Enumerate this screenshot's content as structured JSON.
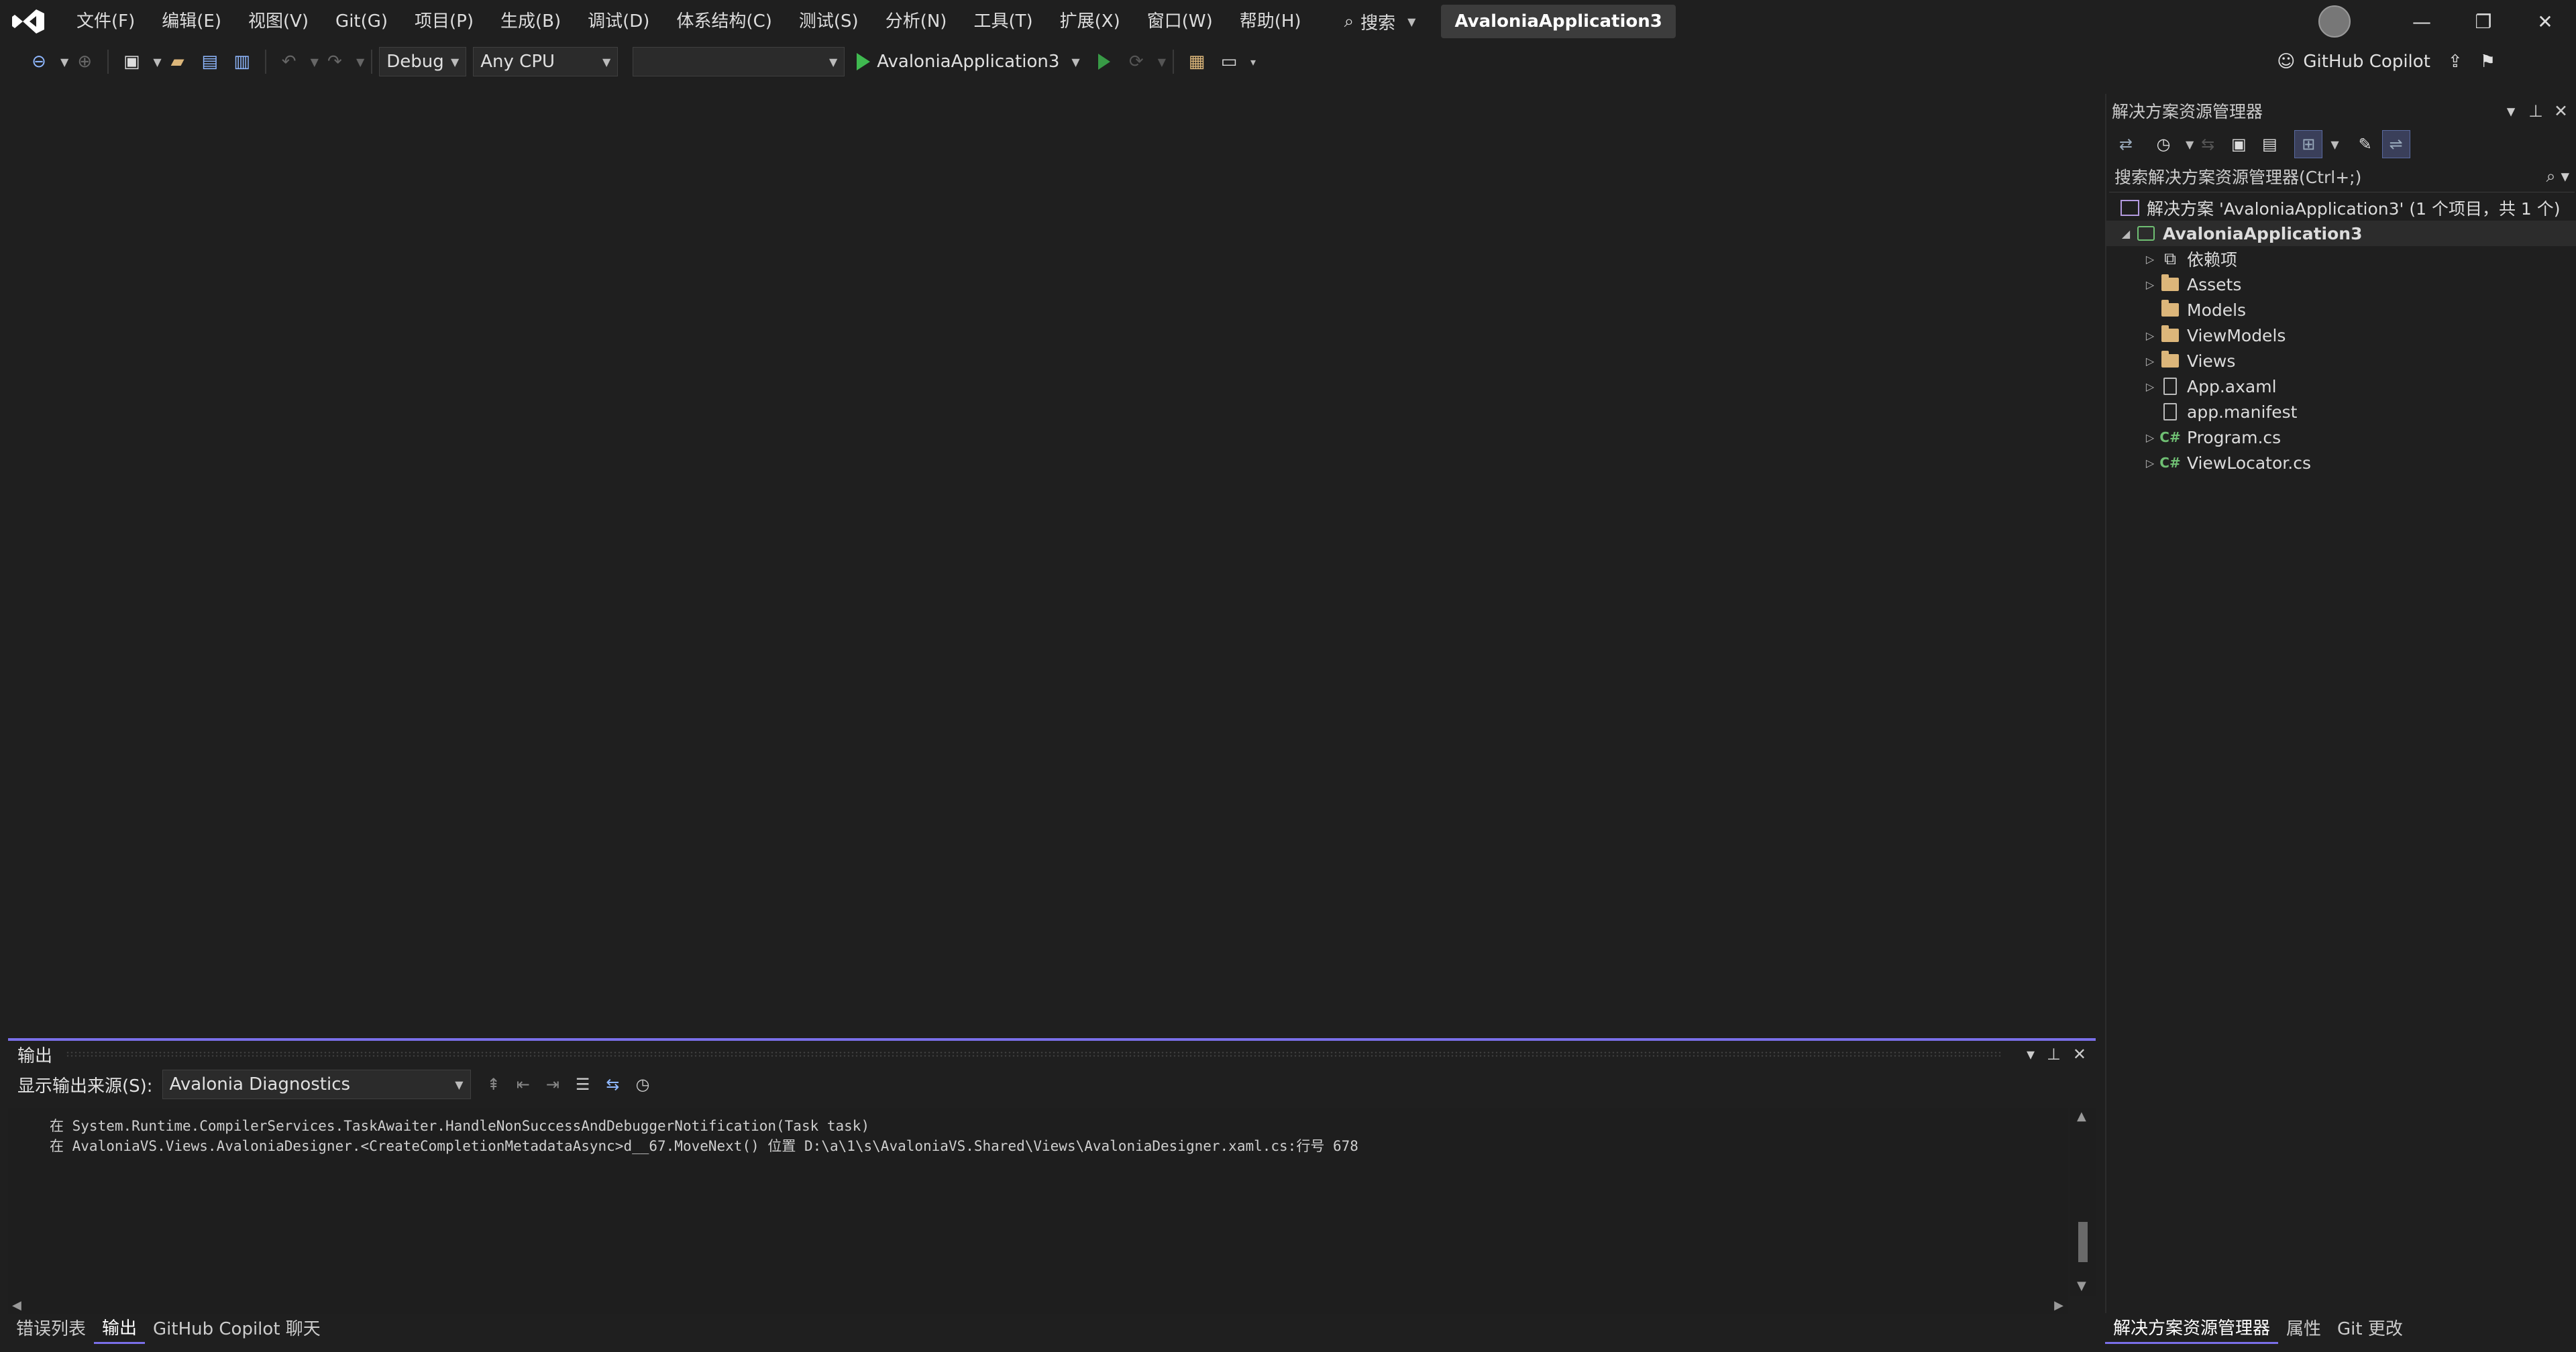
{
  "menu": {
    "items": [
      "文件(F)",
      "编辑(E)",
      "视图(V)",
      "Git(G)",
      "项目(P)",
      "生成(B)",
      "调试(D)",
      "体系结构(C)",
      "测试(S)",
      "分析(N)",
      "工具(T)",
      "扩展(X)",
      "窗口(W)",
      "帮助(H)"
    ],
    "search_label": "搜索",
    "solution_badge": "AvaloniaApplication3"
  },
  "toolbar": {
    "config": "Debug",
    "platform": "Any CPU",
    "startup_item": "",
    "run_target": "AvaloniaApplication3",
    "copilot_label": "GitHub Copilot"
  },
  "output": {
    "title": "输出",
    "source_label": "显示输出来源(S):",
    "source_value": "Avalonia Diagnostics",
    "lines": [
      "在 System.Runtime.CompilerServices.TaskAwaiter.HandleNonSuccessAndDebuggerNotification(Task task)",
      "在 AvaloniaVS.Views.AvaloniaDesigner.<CreateCompletionMetadataAsync>d__67.MoveNext() 位置 D:\\a\\1\\s\\AvaloniaVS.Shared\\Views\\AvaloniaDesigner.xaml.cs:行号 678"
    ]
  },
  "bottom_tabs": [
    "错误列表",
    "输出",
    "GitHub Copilot 聊天"
  ],
  "solution_explorer": {
    "title": "解决方案资源管理器",
    "search_placeholder": "搜索解决方案资源管理器(Ctrl+;)",
    "solution_node": "解决方案 'AvaloniaApplication3' (1 个项目，共 1 个)",
    "project_node": "AvaloniaApplication3",
    "children": [
      {
        "label": "依赖项",
        "icon": "dependencies-icon",
        "expandable": true
      },
      {
        "label": "Assets",
        "icon": "folder-icon",
        "expandable": true
      },
      {
        "label": "Models",
        "icon": "folder-icon",
        "expandable": false
      },
      {
        "label": "ViewModels",
        "icon": "folder-icon",
        "expandable": true
      },
      {
        "label": "Views",
        "icon": "folder-icon",
        "expandable": true
      },
      {
        "label": "App.axaml",
        "icon": "xaml-file-icon",
        "expandable": true
      },
      {
        "label": "app.manifest",
        "icon": "manifest-file-icon",
        "expandable": false
      },
      {
        "label": "Program.cs",
        "icon": "csharp-file-icon",
        "expandable": true
      },
      {
        "label": "ViewLocator.cs",
        "icon": "csharp-file-icon",
        "expandable": true
      }
    ],
    "tabs": [
      "解决方案资源管理器",
      "属性",
      "Git 更改"
    ]
  },
  "colors": {
    "accent": "#7a6fe8",
    "run_green": "#3fb950",
    "folder": "#dcb67a"
  }
}
